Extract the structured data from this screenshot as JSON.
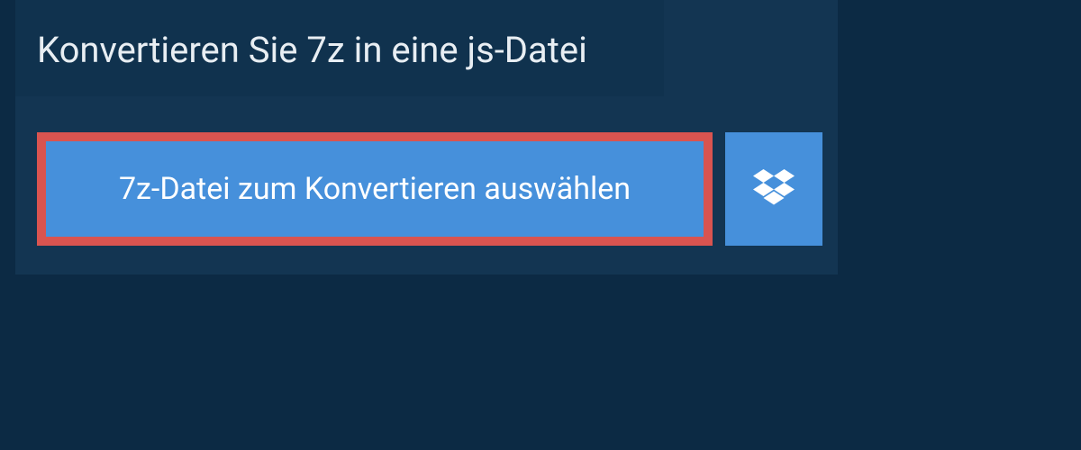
{
  "header": {
    "title": "Konvertieren Sie 7z in eine js-Datei"
  },
  "actions": {
    "select_file_label": "7z-Datei zum Konvertieren auswählen",
    "dropbox_icon": "dropbox-icon"
  },
  "colors": {
    "page_bg": "#0c2a44",
    "panel_bg": "#133552",
    "header_bg": "#10324e",
    "button_bg": "#4690db",
    "highlight_border": "#d95450",
    "text_light": "#e8eef3"
  }
}
